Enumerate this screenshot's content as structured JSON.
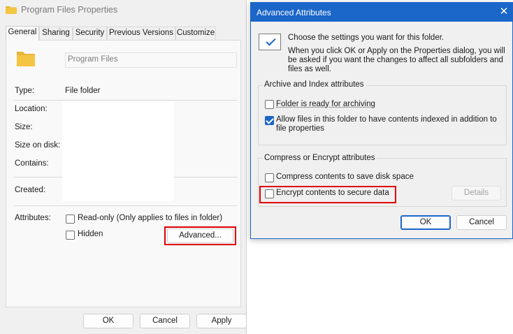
{
  "properties": {
    "title": "Program Files Properties",
    "tabs": [
      "General",
      "Sharing",
      "Security",
      "Previous Versions",
      "Customize"
    ],
    "active_tab": "General",
    "name_value": "Program Files",
    "type_label": "Type:",
    "type_value": "File folder",
    "location_label": "Location:",
    "size_label": "Size:",
    "size_on_disk_label": "Size on disk:",
    "contains_label": "Contains:",
    "created_label": "Created:",
    "attributes_label": "Attributes:",
    "readonly_label": "Read-only (Only applies to files in folder)",
    "readonly_checked": false,
    "hidden_label": "Hidden",
    "hidden_checked": false,
    "advanced_button": "Advanced...",
    "ok_button": "OK",
    "cancel_button": "Cancel",
    "apply_button": "Apply"
  },
  "advanced": {
    "title": "Advanced Attributes",
    "intro_main": "Choose the settings you want for this folder.",
    "intro_detail": "When you click OK or Apply on the Properties dialog, you will be asked if you want the changes to affect all subfolders and files as well.",
    "archive_group_title": "Archive and Index attributes",
    "archive_label": "Folder is ready for archiving",
    "archive_checked": false,
    "index_label": "Allow files in this folder to have contents indexed in addition to file properties",
    "index_checked": true,
    "compress_group_title": "Compress or Encrypt attributes",
    "compress_label": "Compress contents to save disk space",
    "compress_checked": false,
    "encrypt_label": "Encrypt contents to secure data",
    "encrypt_checked": false,
    "details_button": "Details",
    "ok_button": "OK",
    "cancel_button": "Cancel"
  },
  "colors": {
    "accent": "#1b66c9",
    "highlight": "#e00000",
    "folder": "#f4c542"
  },
  "icons": {
    "folder": "folder-icon",
    "close": "close-icon",
    "settings_check": "checkmark-icon"
  }
}
